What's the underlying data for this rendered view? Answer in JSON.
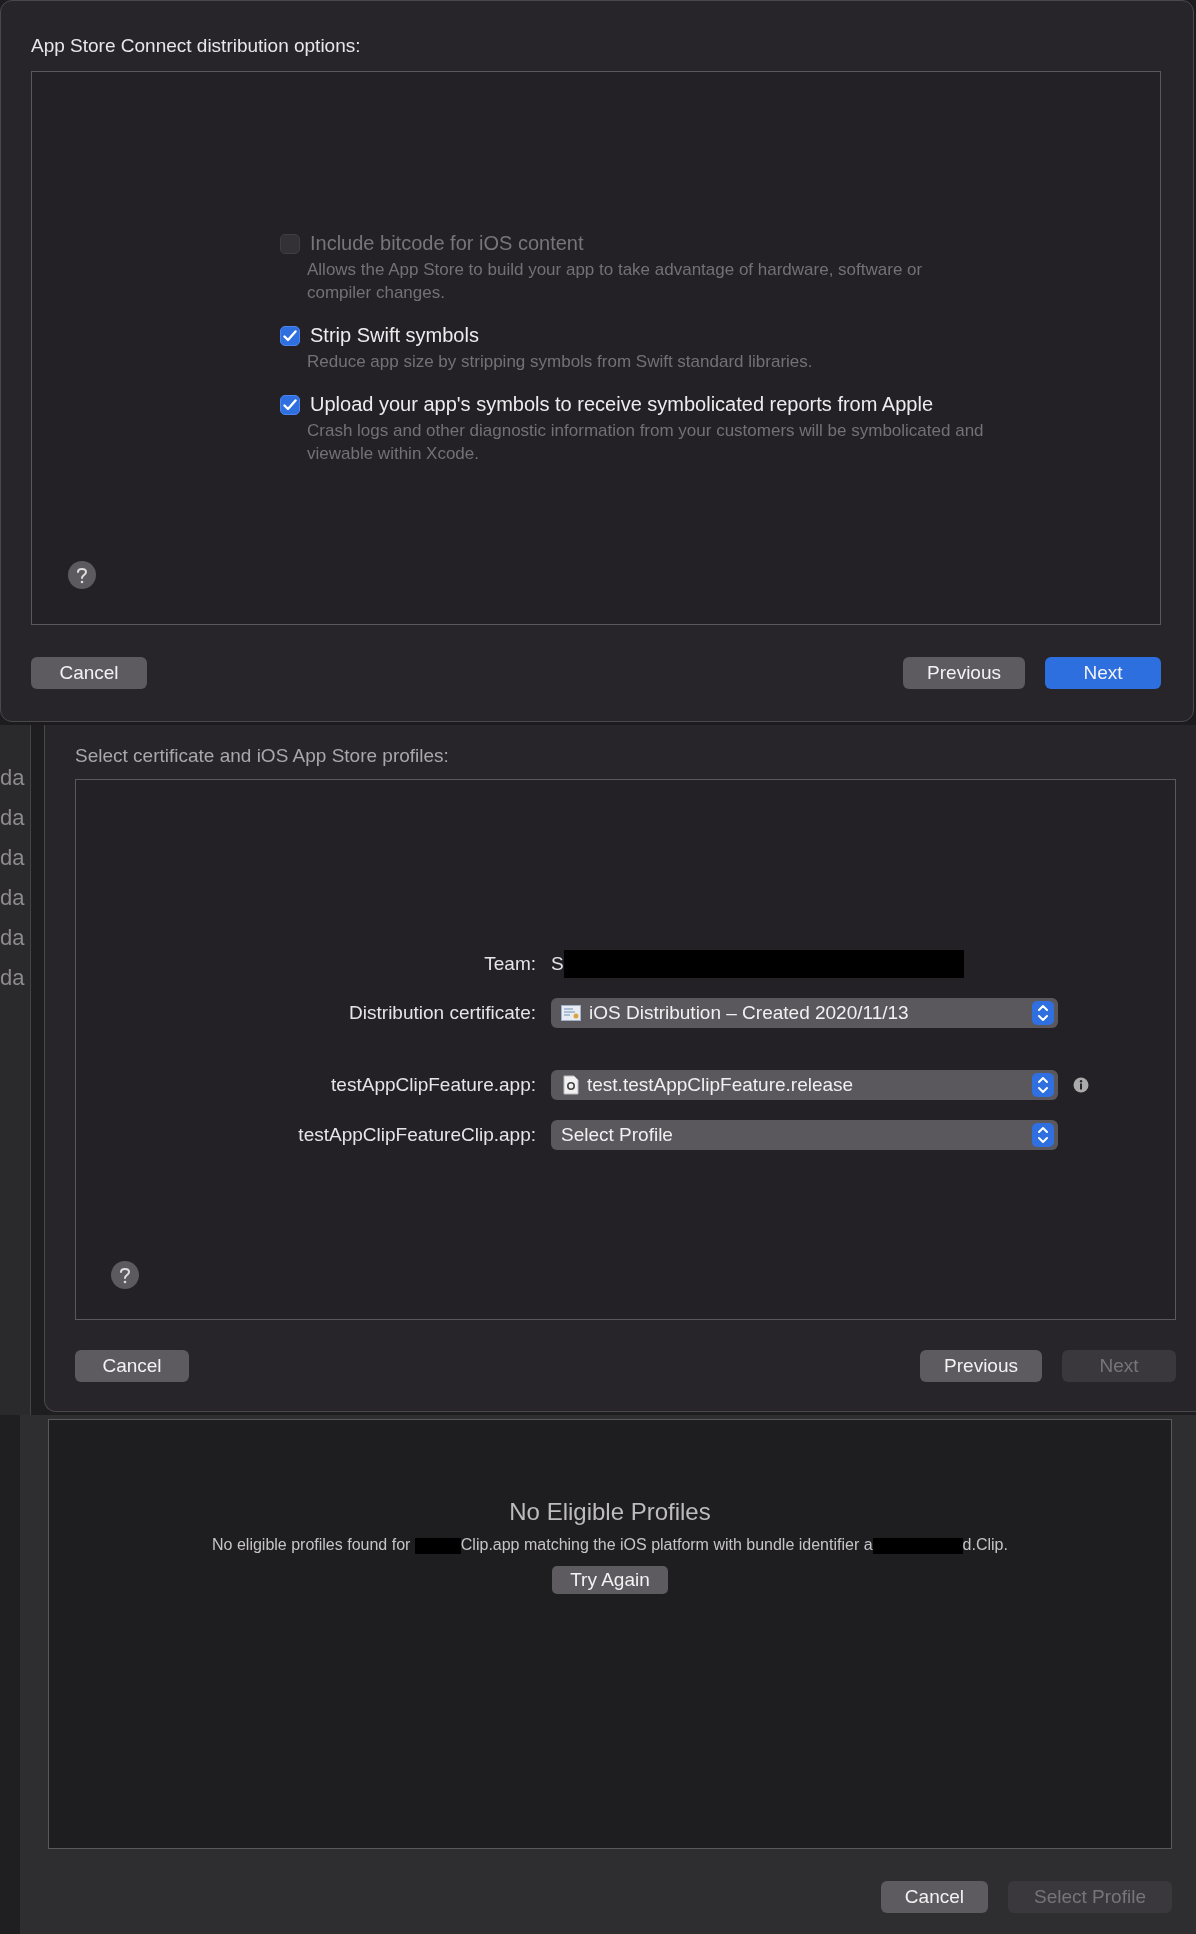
{
  "options_dialog": {
    "title": "App Store Connect distribution options:",
    "options": [
      {
        "label": "Include bitcode for iOS content",
        "description": "Allows the App Store to build your app to take advantage of hardware, software or compiler changes.",
        "checked": false,
        "disabled": true
      },
      {
        "label": "Strip Swift symbols",
        "description": "Reduce app size by stripping symbols from Swift standard libraries.",
        "checked": true,
        "disabled": false
      },
      {
        "label": "Upload your app's symbols to receive symbolicated reports from Apple",
        "description": "Crash logs and other diagnostic information from your customers will be symbolicated and viewable within Xcode.",
        "checked": true,
        "disabled": false
      }
    ],
    "buttons": [
      {
        "label": "Cancel",
        "kind": "normal"
      },
      {
        "label": "Previous",
        "kind": "normal"
      },
      {
        "label": "Next",
        "kind": "primary"
      }
    ]
  },
  "profiles_dialog": {
    "background_fragments": [
      "da",
      "da",
      "da",
      "da",
      "da",
      "da"
    ],
    "title": "Select certificate and iOS App Store profiles:",
    "team": {
      "label": "Team:",
      "value": "S",
      "redacted": true
    },
    "certificate": {
      "label": "Distribution certificate:",
      "value": "iOS Distribution – Created 2020/11/13"
    },
    "profiles": [
      {
        "label": "testAppClipFeature.app:",
        "value": "test.testAppClipFeature.release",
        "kind": "profile",
        "info": true
      },
      {
        "label": "testAppClipFeatureClip.app:",
        "value": "Select Profile",
        "kind": "placeholder",
        "info": false
      }
    ],
    "buttons": [
      {
        "label": "Cancel",
        "kind": "normal"
      },
      {
        "label": "Previous",
        "kind": "normal"
      },
      {
        "label": "Next",
        "kind": "disabled"
      }
    ]
  },
  "no_profiles_sheet": {
    "title": "No Eligible Profiles",
    "message_parts": [
      {
        "kind": "text",
        "text": "No eligible profiles found for "
      },
      {
        "kind": "redacted"
      },
      {
        "kind": "text",
        "text": "Clip.app matching the iOS platform with bundle identifier a"
      },
      {
        "kind": "redacted"
      },
      {
        "kind": "text",
        "text": "d.Clip."
      }
    ],
    "retry": "Try Again",
    "buttons": [
      {
        "label": "Cancel",
        "kind": "normal"
      },
      {
        "label": "Select Profile",
        "kind": "disabled"
      }
    ]
  }
}
